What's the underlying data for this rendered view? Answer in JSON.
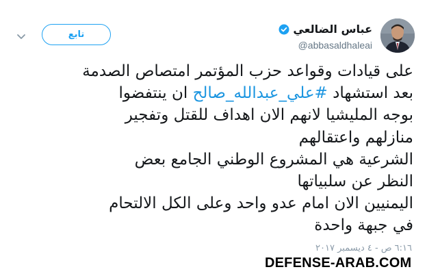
{
  "author": {
    "display_name": "عباس الضالعي",
    "handle": "@abbasaldhaleai",
    "verified": true,
    "avatar_icon": "avatar-photo"
  },
  "actions": {
    "follow_label": "تابع",
    "menu_icon": "chevron-down-icon"
  },
  "tweet": {
    "line1": "على قيادات وقواعد حزب المؤتمر امتصاص الصدمة",
    "line2_before": "بعد استشهاد ",
    "hashtag": "#علي_عبدالله_صالح",
    "line2_after": " ان ينتفضوا",
    "line3": "بوجه المليشيا لانهم الان اهداف للقتل وتفجير",
    "line4": "منازلهم واعتقالهم",
    "line5": "الشرعية هي المشروع الوطني الجامع بعض",
    "line6": "النظر عن سلبياتها",
    "line7": "اليمنيين الان امام عدو واحد وعلى الكل الالتحام",
    "line8": "في جبهة واحدة"
  },
  "meta": {
    "timestamp": "٦:١٦ ص - ٤ ديسمبر ٢٠١٧"
  },
  "watermark": "DEFENSE-ARAB.COM",
  "colors": {
    "accent": "#1da1f2",
    "hashtag": "#1b95e0",
    "text": "#14171a",
    "muted": "#657786"
  }
}
